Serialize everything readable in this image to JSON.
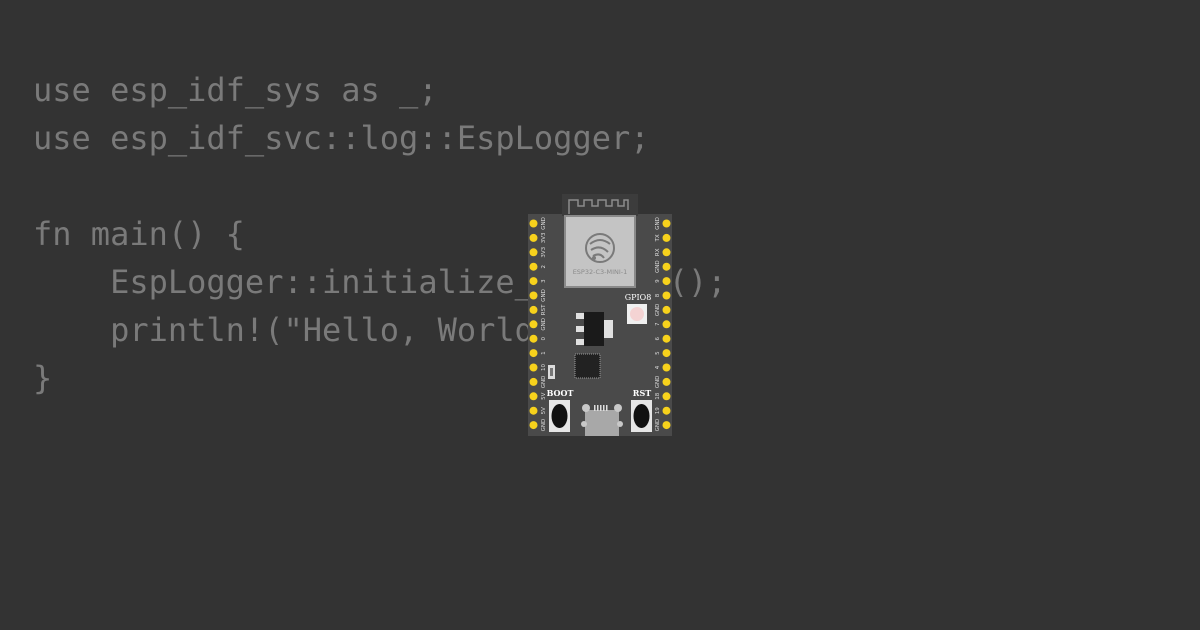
{
  "code": {
    "lines": [
      "use esp_idf_sys as _;",
      "use esp_idf_svc::log::EspLogger;",
      "",
      "fn main() {",
      "    EspLogger::initialize_default();",
      "    println!(\"Hello, World!\");",
      "}"
    ]
  },
  "board": {
    "module_label": "ESP32-C3-MINI-1",
    "led_label": "GPIO8",
    "boot_label": "BOOT",
    "reset_label": "RST",
    "left_pins": [
      "GND",
      "3V3",
      "3V3",
      "2",
      "3",
      "GND",
      "RST",
      "GND",
      "0",
      "1",
      "10",
      "GND",
      "5V",
      "5V",
      "GND"
    ],
    "right_pins": [
      "GND",
      "TX",
      "RX",
      "GND",
      "9",
      "8",
      "GND",
      "7",
      "6",
      "5",
      "4",
      "GND",
      "18",
      "19",
      "GND"
    ],
    "colors": {
      "background": "#333333",
      "pcb": "#4a4a4a",
      "pin": "#f7d21c",
      "module": "#c4c4c4",
      "code_text": "#7a7a7a"
    },
    "icons": [
      "espressif-logo-icon",
      "antenna-icon",
      "usb-connector-icon"
    ]
  }
}
